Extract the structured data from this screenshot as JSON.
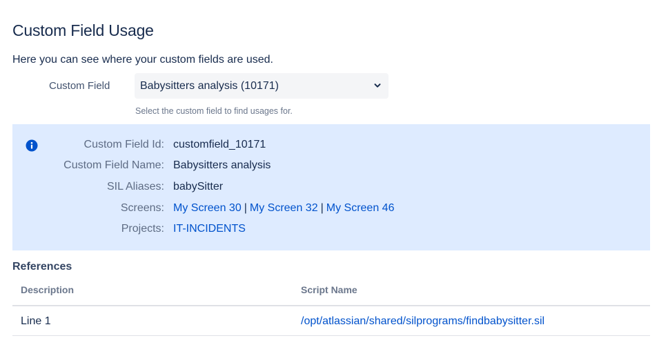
{
  "page": {
    "title": "Custom Field Usage",
    "intro": "Here you can see where your custom fields are used."
  },
  "selector": {
    "label": "Custom Field",
    "selected": "Babysitters analysis (10171)",
    "hint": "Select the custom field to find usages for."
  },
  "info": {
    "icon": "info-icon",
    "rows": [
      {
        "key": "Custom Field Id:",
        "value": "customfield_10171"
      },
      {
        "key": "Custom Field Name:",
        "value": "Babysitters analysis"
      },
      {
        "key": "SIL Aliases:",
        "value": "babySitter"
      },
      {
        "key": "Screens:",
        "links": [
          "My Screen 30",
          "My Screen 32",
          "My Screen 46"
        ],
        "separator": "|"
      },
      {
        "key": "Projects:",
        "links": [
          "IT-INCIDENTS"
        ]
      }
    ]
  },
  "references": {
    "title": "References",
    "columns": [
      "Description",
      "Script Name"
    ],
    "rows": [
      {
        "description": "Line 1",
        "script": "/opt/atlassian/shared/silprograms/findbabysitter.sil"
      }
    ]
  },
  "colors": {
    "panel_bg": "#deebff",
    "link": "#0052cc",
    "info_icon": "#0052cc",
    "text": "#172b4d",
    "muted": "#5e6c84"
  }
}
